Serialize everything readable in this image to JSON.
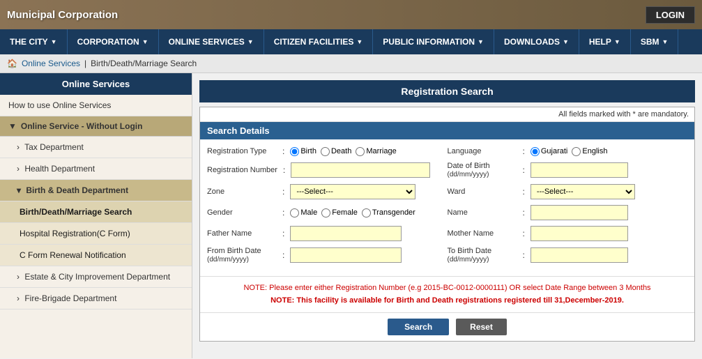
{
  "header": {
    "corporation_name": "Municipal Corporation",
    "login_label": "LOGIN"
  },
  "navbar": {
    "items": [
      {
        "label": "THE CITY",
        "id": "the-city"
      },
      {
        "label": "CORPORATION",
        "id": "corporation"
      },
      {
        "label": "ONLINE SERVICES",
        "id": "online-services"
      },
      {
        "label": "CITIZEN FACILITIES",
        "id": "citizen-facilities"
      },
      {
        "label": "PUBLIC INFORMATION",
        "id": "public-information"
      },
      {
        "label": "DOWNLOADS",
        "id": "downloads"
      },
      {
        "label": "HELP",
        "id": "help"
      },
      {
        "label": "SBM",
        "id": "sbm"
      }
    ]
  },
  "breadcrumb": {
    "home_icon": "🏠",
    "online_services": "Online Services",
    "separator": "|",
    "current_page": "Birth/Death/Marriage Search"
  },
  "sidebar": {
    "header": "Online Services",
    "items": [
      {
        "label": "How to use Online Services",
        "type": "link",
        "id": "how-to-use"
      },
      {
        "label": "Online Service - Without Login",
        "type": "section",
        "id": "without-login"
      },
      {
        "label": "Tax Department",
        "type": "sub",
        "id": "tax-dept"
      },
      {
        "label": "Health Department",
        "type": "sub",
        "id": "health-dept"
      },
      {
        "label": "Birth & Death Department",
        "type": "sub-open",
        "id": "birth-death-dept"
      },
      {
        "label": "Birth/Death/Marriage Search",
        "type": "sub2",
        "id": "birth-death-search"
      },
      {
        "label": "Hospital Registration(C Form)",
        "type": "sub2",
        "id": "hospital-reg"
      },
      {
        "label": "C Form Renewal Notification",
        "type": "sub2",
        "id": "c-form-renewal"
      },
      {
        "label": "Estate & City Improvement Department",
        "type": "sub",
        "id": "estate-dept"
      },
      {
        "label": "Fire-Brigade Department",
        "type": "sub",
        "id": "fire-brigade"
      }
    ]
  },
  "main": {
    "content_header": "Registration Search",
    "mandatory_note": "All fields marked with * are mandatory.",
    "search_details_header": "Search Details",
    "form": {
      "registration_type_label": "Registration Type",
      "reg_type_options": [
        "Birth",
        "Death",
        "Marriage"
      ],
      "reg_type_default": "Birth",
      "language_label": "Language",
      "language_options": [
        "Gujarati",
        "English"
      ],
      "language_default": "Gujarati",
      "registration_number_label": "Registration Number",
      "dob_label": "Date of Birth\n(dd/mm/yyyy)",
      "zone_label": "Zone",
      "zone_options": [
        "---Select---"
      ],
      "zone_placeholder": "---Select---",
      "ward_label": "Ward",
      "ward_options": [
        "---Select---"
      ],
      "ward_placeholder": "---Select---",
      "gender_label": "Gender",
      "gender_options": [
        "Male",
        "Female",
        "Transgender"
      ],
      "name_label": "Name",
      "father_name_label": "Father Name",
      "mother_name_label": "Mother Name",
      "from_birth_date_label": "From Birth Date\n(dd/mm/yyyy)",
      "to_birth_date_label": "To Birth Date\n(dd/mm/yyyy)",
      "note1": "NOTE: Please enter either Registration Number (e.g 2015-BC-0012-0000111) OR select Date Range between 3 Months",
      "note2": "NOTE: This facility is available for Birth and Death registrations registered till 31,December-2019.",
      "search_btn": "Search",
      "reset_btn": "Reset"
    }
  }
}
